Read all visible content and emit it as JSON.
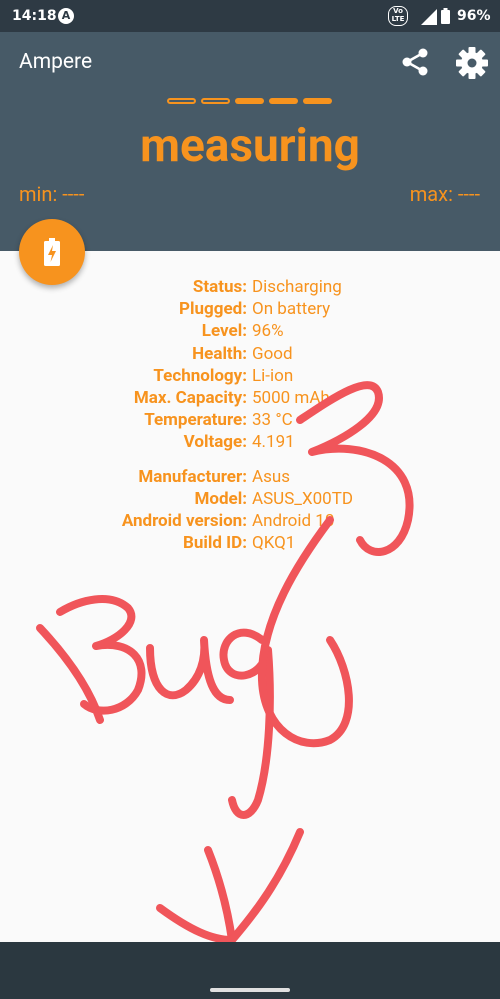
{
  "status_bar": {
    "time": "14:18",
    "notification_icon": "A",
    "volte_label": "Vo LTE",
    "battery_percent": "96%"
  },
  "app_bar": {
    "title": "Ampere",
    "share_icon": "share-icon",
    "settings_icon": "gear-icon"
  },
  "measure": {
    "progress_segments_total": 5,
    "progress_segments_filled": 3,
    "state": "measuring",
    "min": "min: ----",
    "max": "max: ----"
  },
  "battery_info": [
    {
      "label": "Status:",
      "value": "Discharging"
    },
    {
      "label": "Plugged:",
      "value": "On battery"
    },
    {
      "label": "Level:",
      "value": "96%"
    },
    {
      "label": "Health:",
      "value": "Good"
    },
    {
      "label": "Technology:",
      "value": "Li-ion"
    },
    {
      "label": "Max. Capacity:",
      "value": "5000 mAh"
    },
    {
      "label": "Temperature:",
      "value": "33 °C"
    },
    {
      "label": "Voltage:",
      "value": "4.191"
    }
  ],
  "device_info": [
    {
      "label": "Manufacturer:",
      "value": "Asus"
    },
    {
      "label": "Model:",
      "value": "ASUS_X00TD"
    },
    {
      "label": "Android version:",
      "value": "Android 10"
    },
    {
      "label": "Build ID:",
      "value": "QKQ1"
    }
  ],
  "annotation": {
    "handwriting": "Bug",
    "color": "#f0555a"
  },
  "colors": {
    "accent": "#f7931e",
    "header": "#475a67",
    "status_bar": "#2e3a44"
  }
}
